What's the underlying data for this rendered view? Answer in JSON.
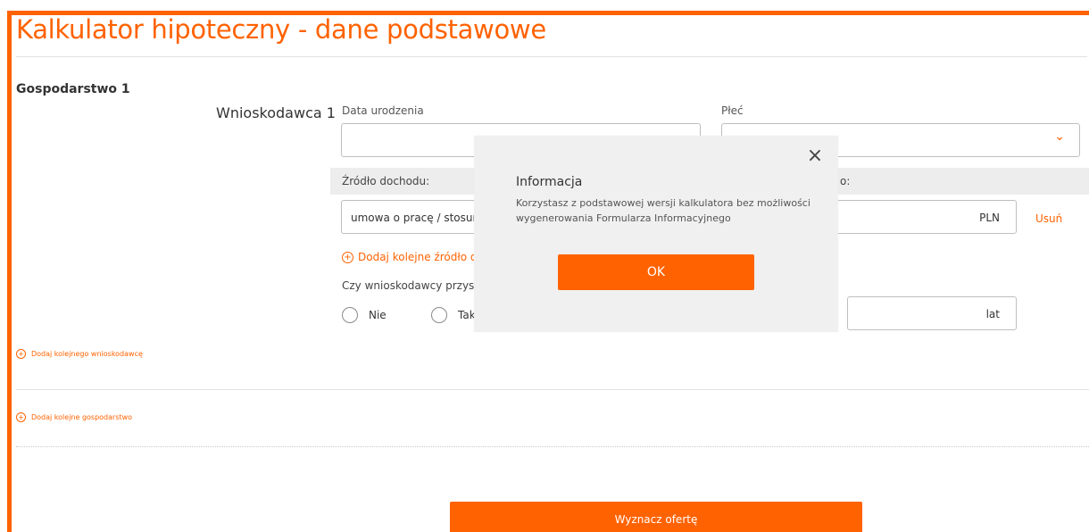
{
  "page": {
    "title": "Kalkulator hipoteczny - dane podstawowe"
  },
  "household": {
    "label": "Gospodarstwo 1",
    "applicant": {
      "label": "Wnioskodawca 1",
      "birth_date_label": "Data urodzenia",
      "birth_date_value": "",
      "gender_label": "Płeć",
      "gender_value": "",
      "income_source_label": "Źródło dochodu:",
      "income_amount_label_tail": "o:",
      "income_source_value": "umowa o pracę / stosun",
      "income_currency": "PLN",
      "remove_link": "Usuń",
      "add_income_link": "Dodaj kolejne źródło do",
      "question_label": "Czy wnioskodawcy przysłu",
      "radio_no": "Nie",
      "radio_yes": "Tak",
      "years_unit": "lat"
    },
    "add_applicant_link": "Dodaj kolejnego wnioskodawcę"
  },
  "add_household_link": "Dodaj kolejne gospodarstwo",
  "cta": {
    "label": "Wyznacz ofertę"
  },
  "modal": {
    "title": "Informacja",
    "body": "Korzystasz z podstawowej wersji kalkulatora bez możliwości wygenerowania Formularza Informacyjnego",
    "ok_label": "OK",
    "close_icon": "×"
  },
  "icons": {
    "chevron": "⌄",
    "plus": "+"
  },
  "colors": {
    "brand": "#ff6200",
    "modal_bg": "#f0f0f0",
    "band_bg": "#ededed"
  }
}
